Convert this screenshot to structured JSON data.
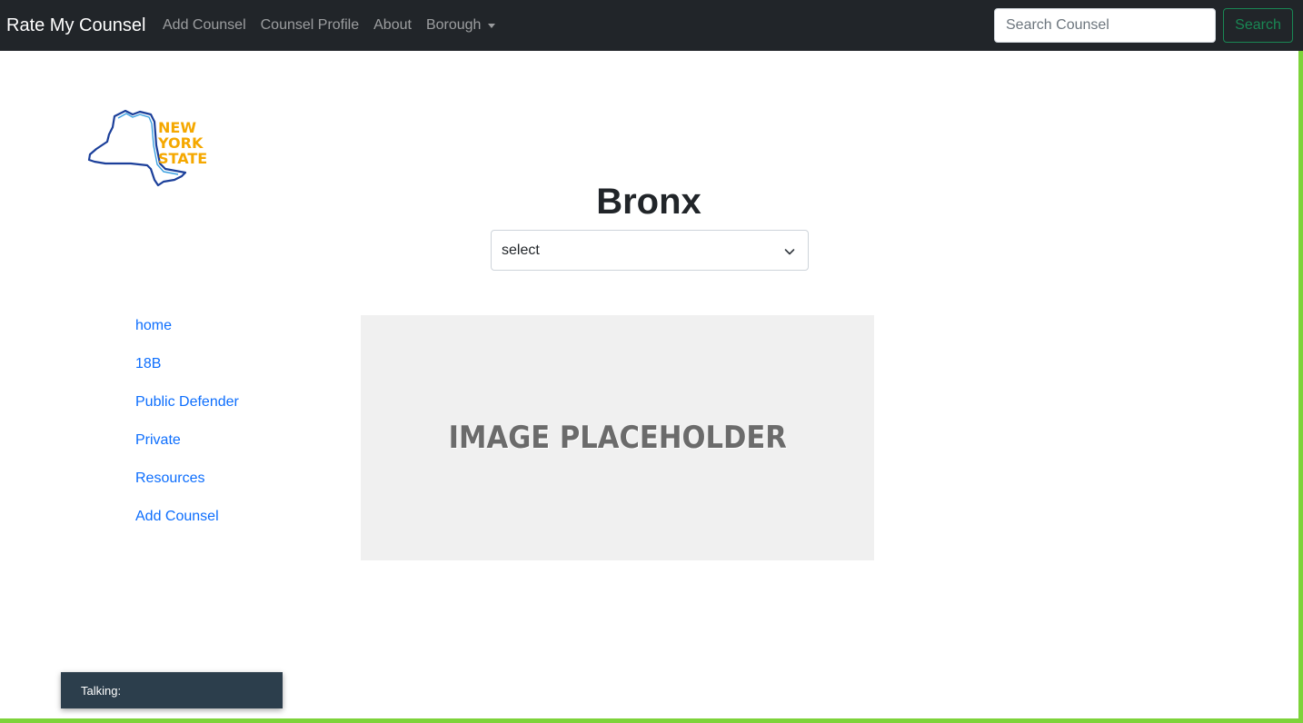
{
  "navbar": {
    "brand": "Rate My Counsel",
    "links": [
      "Add Counsel",
      "Counsel Profile",
      "About"
    ],
    "dropdown_label": "Borough",
    "search_placeholder": "Search Counsel",
    "search_button": "Search"
  },
  "logo": {
    "lines": [
      "NEW",
      "YORK",
      "STATE"
    ]
  },
  "main": {
    "title": "Bronx",
    "select_value": "select",
    "placeholder_text": "IMAGE PLACEHOLDER"
  },
  "sidebar": {
    "items": [
      {
        "label": "home"
      },
      {
        "label": "18B"
      },
      {
        "label": "Public Defender"
      },
      {
        "label": "Private"
      },
      {
        "label": "Resources"
      },
      {
        "label": "Add Counsel"
      }
    ]
  },
  "talking": {
    "label": "Talking:"
  },
  "colors": {
    "navbar_bg": "#212529",
    "link": "#0d6efd",
    "search_button": "#198754",
    "frame": "#7dd33a",
    "logo_text": "#f5a800",
    "logo_outline": "#1b3f9a"
  }
}
